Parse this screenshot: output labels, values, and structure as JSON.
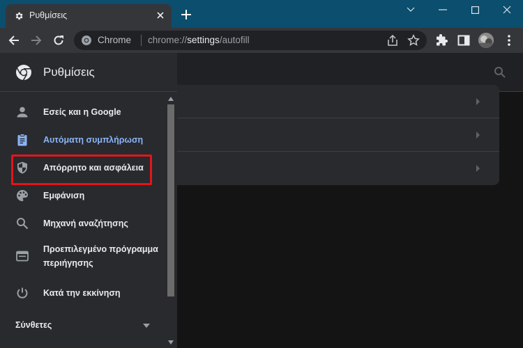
{
  "window": {
    "tab_title": "Ρυθμίσεις",
    "controls": [
      "minimize",
      "maximize",
      "close"
    ]
  },
  "toolbar": {
    "site_name": "Chrome",
    "url_prefix": "chrome://",
    "url_host": "settings",
    "url_path": "/autofill"
  },
  "sidebar": {
    "title": "Ρυθμίσεις",
    "items": [
      {
        "label": "Εσείς και η Google",
        "icon": "person-icon"
      },
      {
        "label": "Αυτόματη συμπλήρωση",
        "icon": "clipboard-icon",
        "active": true
      },
      {
        "label": "Απόρρητο και ασφάλεια",
        "icon": "shield-icon",
        "highlighted": true
      },
      {
        "label": "Εμφάνιση",
        "icon": "palette-icon"
      },
      {
        "label": "Μηχανή αναζήτησης",
        "icon": "search-icon"
      },
      {
        "label_line1": "Προεπιλεγμένο πρόγραμμα",
        "label_line2": "περιήγησης",
        "icon": "browser-icon"
      },
      {
        "label": "Κατά την εκκίνηση",
        "icon": "power-icon"
      }
    ],
    "section": "Σύνθετες"
  },
  "colors": {
    "accent": "#8ab4f8",
    "highlight": "#e5141b",
    "titlebar": "#0b4e6e"
  }
}
